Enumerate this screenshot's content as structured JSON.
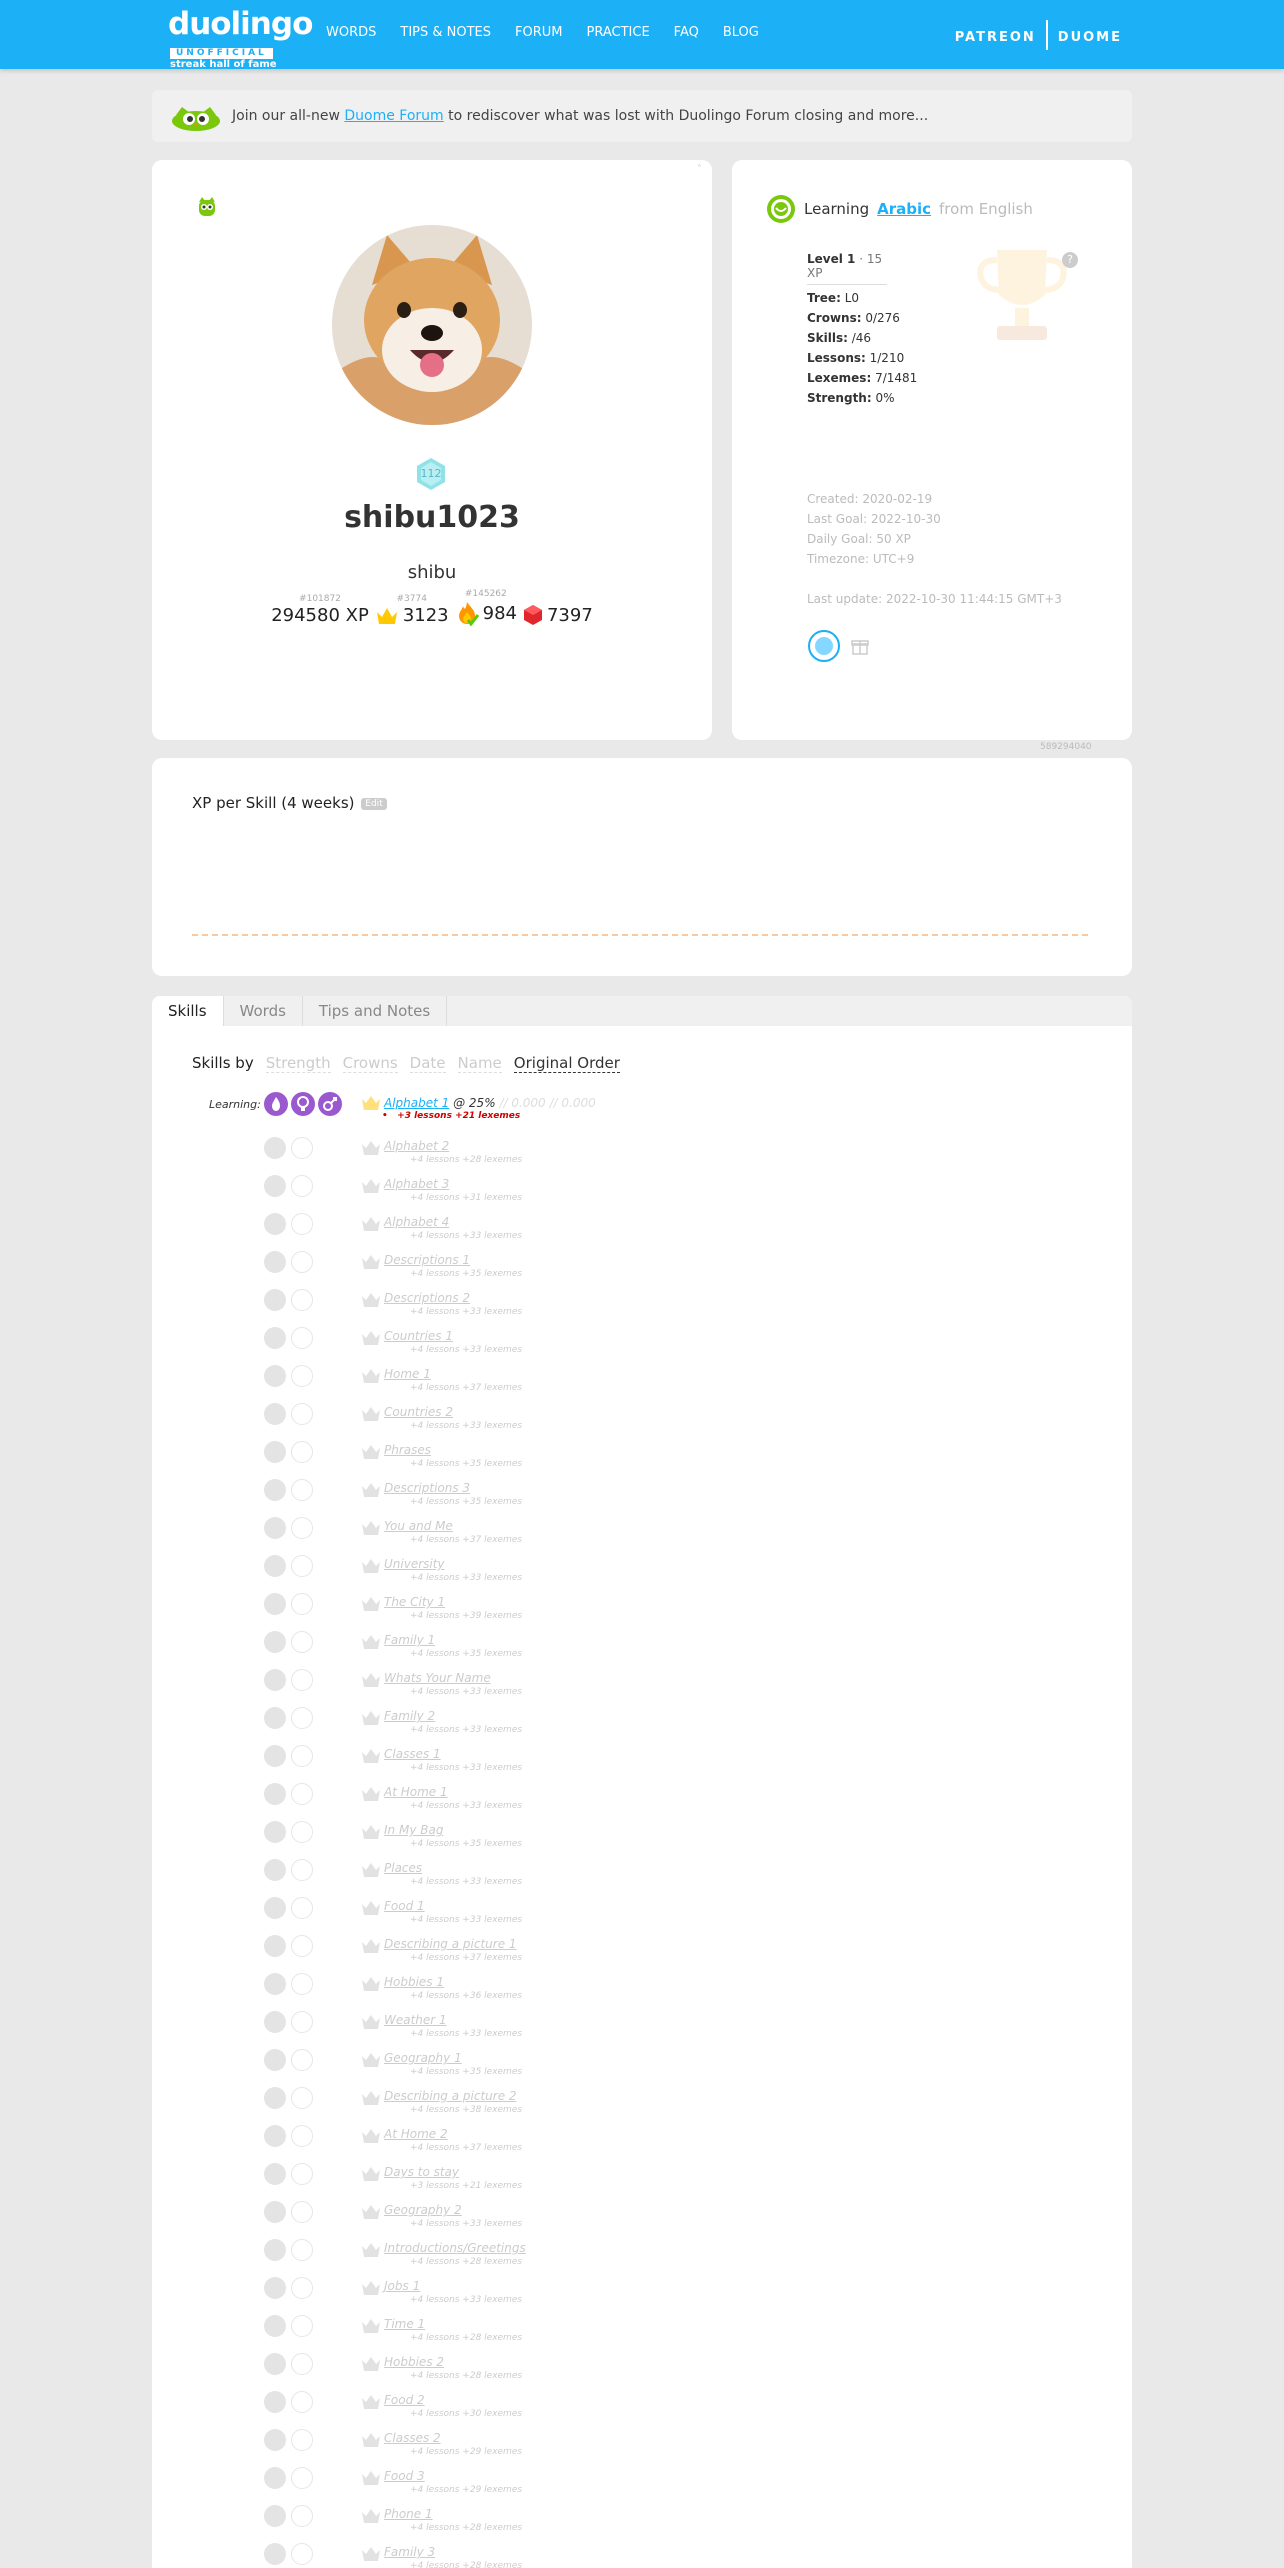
{
  "header": {
    "logo_word": "duolingo",
    "logo_badge": "UNOFFICIAL",
    "logo_sub": "streak hall of fame",
    "nav": [
      "WORDS",
      "TIPS & NOTES",
      "FORUM",
      "PRACTICE",
      "FAQ",
      "BLOG"
    ],
    "right": [
      "PATREON",
      "DUOME"
    ]
  },
  "banner": {
    "before": "Join our all-new ",
    "link": "Duome Forum",
    "after": " to rediscover what was lost with Duolingo Forum closing and more..."
  },
  "profile": {
    "level": "112",
    "username": "shibu1023",
    "realname": "shibu",
    "xp": "294580 XP",
    "xp_rank": "#101872",
    "crowns": "3123",
    "crowns_rank": "#3774",
    "streak": "984",
    "streak_rank": "#145262",
    "gems": "7397"
  },
  "learning": {
    "prefix": "Learning",
    "language": "Arabic",
    "from": "from English",
    "level_label": "Level 1",
    "level_xp": "· 15 XP",
    "help": "?",
    "kv": [
      {
        "k": "Tree:",
        "v": " L0"
      },
      {
        "k": "Crowns:",
        "v": " 0/276"
      },
      {
        "k": "Skills:",
        "v": " /46"
      },
      {
        "k": "Lessons:",
        "v": " 1/210"
      },
      {
        "k": "Lexemes:",
        "v": " 7/1481"
      },
      {
        "k": "Strength:",
        "v": " 0%"
      }
    ],
    "meta": [
      "Created: 2020-02-19",
      "Last Goal: 2022-10-30",
      "Daily Goal: 50 XP",
      "Timezone: UTC+9"
    ],
    "last_update": "Last update: 2022-10-30 11:44:15 GMT+3",
    "user_id": "589294040"
  },
  "xp_chart": {
    "title": "XP per Skill (4 weeks)",
    "edit": "Edit"
  },
  "tabs": [
    "Skills",
    "Words",
    "Tips and Notes"
  ],
  "skills_sort": {
    "label": "Skills by",
    "options": [
      "Strength",
      "Crowns",
      "Date",
      "Name",
      "Original Order"
    ],
    "active": "Original Order"
  },
  "skills_first": {
    "learning_label": "Learning:",
    "name": "Alphabet 1",
    "pct": "@ 25%",
    "rest": "// 0.000 // 0.000",
    "sub": "+3 lessons +21 lexemes"
  },
  "skills": [
    {
      "name": "Alphabet 2",
      "sub": "+4 lessons +28 lexemes"
    },
    {
      "name": "Alphabet 3",
      "sub": "+4 lessons +31 lexemes"
    },
    {
      "name": "Alphabet 4",
      "sub": "+4 lessons +33 lexemes"
    },
    {
      "name": "Descriptions 1",
      "sub": "+4 lessons +35 lexemes"
    },
    {
      "name": "Descriptions 2",
      "sub": "+4 lessons +33 lexemes"
    },
    {
      "name": "Countries 1",
      "sub": "+4 lessons +33 lexemes"
    },
    {
      "name": "Home 1",
      "sub": "+4 lessons +37 lexemes"
    },
    {
      "name": "Countries 2",
      "sub": "+4 lessons +33 lexemes"
    },
    {
      "name": "Phrases",
      "sub": "+4 lessons +35 lexemes"
    },
    {
      "name": "Descriptions 3",
      "sub": "+4 lessons +35 lexemes"
    },
    {
      "name": "You and Me",
      "sub": "+4 lessons +37 lexemes"
    },
    {
      "name": "University",
      "sub": "+4 lessons +33 lexemes"
    },
    {
      "name": "The City 1",
      "sub": "+4 lessons +39 lexemes"
    },
    {
      "name": "Family 1",
      "sub": "+4 lessons +35 lexemes"
    },
    {
      "name": "Whats Your Name",
      "sub": "+4 lessons +33 lexemes"
    },
    {
      "name": "Family 2",
      "sub": "+4 lessons +33 lexemes"
    },
    {
      "name": "Classes 1",
      "sub": "+4 lessons +33 lexemes"
    },
    {
      "name": "At Home 1",
      "sub": "+4 lessons +33 lexemes"
    },
    {
      "name": "In My Bag",
      "sub": "+4 lessons +35 lexemes"
    },
    {
      "name": "Places",
      "sub": "+4 lessons +33 lexemes"
    },
    {
      "name": "Food 1",
      "sub": "+4 lessons +33 lexemes"
    },
    {
      "name": "Describing a picture 1",
      "sub": "+4 lessons +37 lexemes"
    },
    {
      "name": "Hobbies 1",
      "sub": "+4 lessons +36 lexemes"
    },
    {
      "name": "Weather 1",
      "sub": "+4 lessons +33 lexemes"
    },
    {
      "name": "Geography 1",
      "sub": "+4 lessons +35 lexemes"
    },
    {
      "name": "Describing a picture 2",
      "sub": "+4 lessons +38 lexemes"
    },
    {
      "name": "At Home 2",
      "sub": "+4 lessons +37 lexemes"
    },
    {
      "name": "Days to stay",
      "sub": "+3 lessons +21 lexemes"
    },
    {
      "name": "Geography 2",
      "sub": "+4 lessons +33 lexemes"
    },
    {
      "name": "Introductions/Greetings",
      "sub": "+4 lessons +28 lexemes"
    },
    {
      "name": "Jobs 1",
      "sub": "+4 lessons +33 lexemes"
    },
    {
      "name": "Time 1",
      "sub": "+4 lessons +28 lexemes"
    },
    {
      "name": "Hobbies 2",
      "sub": "+4 lessons +28 lexemes"
    },
    {
      "name": "Food 2",
      "sub": "+4 lessons +30 lexemes"
    },
    {
      "name": "Classes 2",
      "sub": "+4 lessons +29 lexemes"
    },
    {
      "name": "Food 3",
      "sub": "+4 lessons +29 lexemes"
    },
    {
      "name": "Phone 1",
      "sub": "+4 lessons +28 lexemes"
    },
    {
      "name": "Family 3",
      "sub": "+4 lessons +28 lexemes"
    }
  ],
  "colors": {
    "topbar": "#1cb0f6",
    "link": "#1cb0f6",
    "learning_purple": "#9b59d0",
    "owl_green": "#7ac70c",
    "sub_red": "#d00000"
  }
}
